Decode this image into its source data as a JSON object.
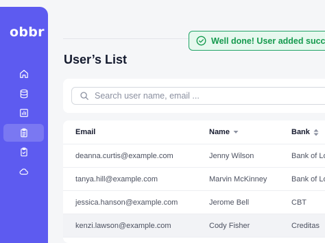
{
  "app": {
    "logo": "obbr"
  },
  "sidebar": {
    "items": [
      {
        "icon": "home-icon"
      },
      {
        "icon": "database-icon"
      },
      {
        "icon": "bar-chart-icon"
      },
      {
        "icon": "clipboard-list-icon",
        "active": true
      },
      {
        "icon": "clipboard-check-icon"
      },
      {
        "icon": "cloud-icon"
      }
    ],
    "colors": {
      "background": "#5d5bf0"
    }
  },
  "toast": {
    "message": "Well done! User added successf",
    "color": "#159a4e"
  },
  "page": {
    "title": "User’s List"
  },
  "search": {
    "placeholder": "Search user name, email ..."
  },
  "table": {
    "columns": [
      {
        "label": "Email"
      },
      {
        "label": "Name",
        "sort_icon": "caret-down-icon"
      },
      {
        "label": "Bank",
        "sort_icon": "sort-icon"
      }
    ],
    "rows": [
      {
        "email": "deanna.curtis@example.com",
        "name": "Jenny Wilson",
        "bank": "Bank of Lo"
      },
      {
        "email": "tanya.hill@example.com",
        "name": "Marvin McKinney",
        "bank": "Bank of Lo"
      },
      {
        "email": "jessica.hanson@example.com",
        "name": "Jerome Bell",
        "bank": "CBT"
      },
      {
        "email": "kenzi.lawson@example.com",
        "name": "Cody Fisher",
        "bank": "Creditas"
      }
    ]
  }
}
